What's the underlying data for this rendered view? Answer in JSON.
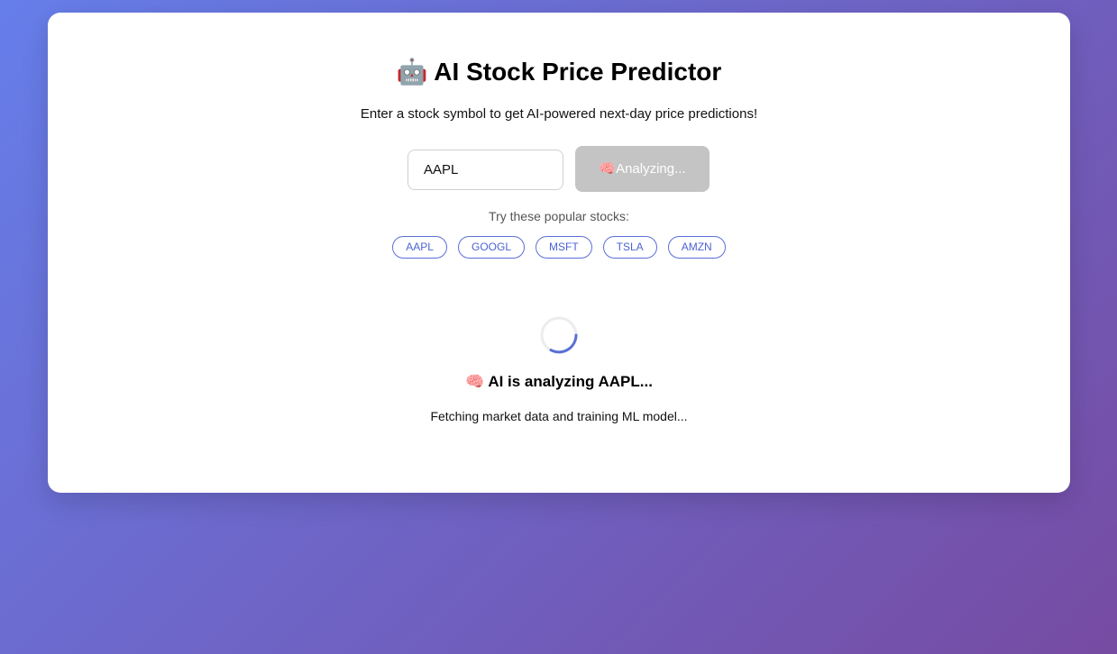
{
  "header": {
    "title_icon": "🤖",
    "title": "AI Stock Price Predictor",
    "subtitle": "Enter a stock symbol to get AI-powered next-day price predictions!"
  },
  "search": {
    "symbol_value": "AAPL",
    "button_icon": "🧠",
    "button_label": "Analyzing..."
  },
  "popular": {
    "label": "Try these popular stocks:",
    "symbols": [
      "AAPL",
      "GOOGL",
      "MSFT",
      "TSLA",
      "AMZN"
    ]
  },
  "loading": {
    "title_icon": "🧠",
    "title": "AI is analyzing AAPL...",
    "message": "Fetching market data and training ML model..."
  },
  "colors": {
    "background_start": "#667eea",
    "background_end": "#764ba2",
    "accent": "#4b63d3",
    "button_disabled": "#c4c4c4"
  }
}
